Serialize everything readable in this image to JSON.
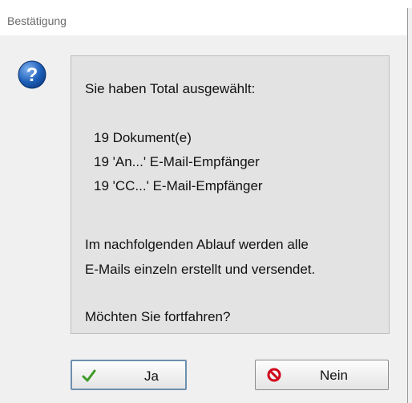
{
  "dialog": {
    "title": "Bestätigung",
    "icon": "question-icon",
    "message": {
      "intro": "Sie haben Total ausgewählt:",
      "items": [
        "19 Dokument(e)",
        "19 'An...' E-Mail-Empfänger",
        "19 'CC...' E-Mail-Empfänger"
      ],
      "info_line1": "Im nachfolgenden Ablauf werden alle",
      "info_line2": "E-Mails einzeln erstellt und versendet.",
      "question": "Möchten Sie fortfahren?"
    },
    "buttons": {
      "yes_label": "Ja",
      "yes_icon": "checkmark-icon",
      "no_label": "Nein",
      "no_icon": "prohibited-icon"
    }
  },
  "colors": {
    "question_icon": "#1d5fb8",
    "check": "#3f9a2a",
    "no_icon": "#d0021b"
  }
}
